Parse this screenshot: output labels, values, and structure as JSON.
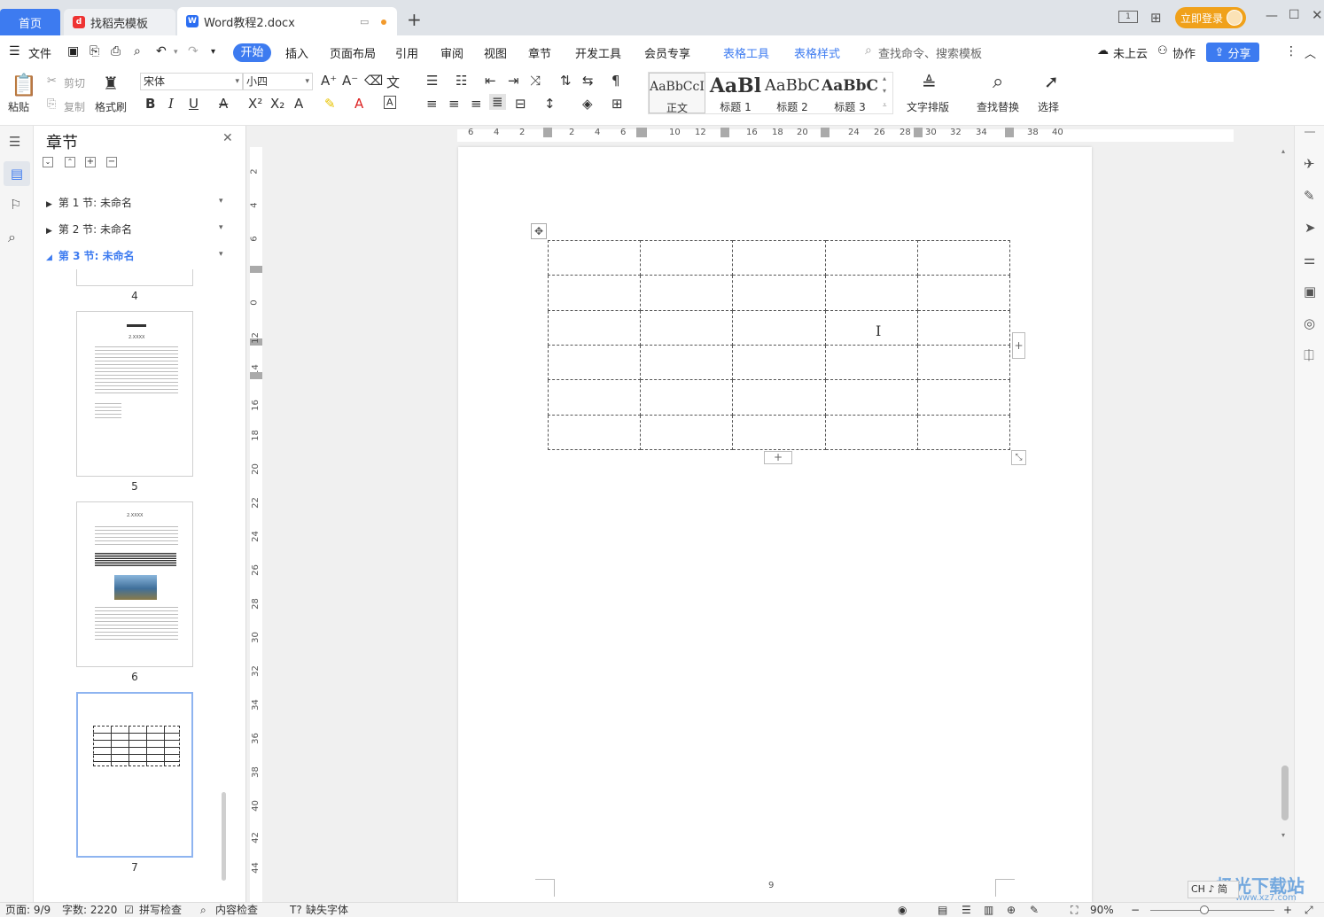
{
  "tabs": {
    "home": "首页",
    "daoke": "找稻壳模板",
    "doc": "Word教程2.docx",
    "login": "立即登录"
  },
  "menu": {
    "file": "文件",
    "items": [
      "开始",
      "插入",
      "页面布局",
      "引用",
      "审阅",
      "视图",
      "章节",
      "开发工具",
      "会员专享"
    ],
    "table_tools": "表格工具",
    "table_style": "表格样式",
    "search": "查找命令、搜索模板",
    "cloud": "未上云",
    "collab": "协作",
    "share": "分享"
  },
  "toolbar": {
    "paste": "粘贴",
    "cut": "剪切",
    "copy": "复制",
    "format_painter": "格式刷",
    "font": "宋体",
    "size": "小四",
    "styles": [
      {
        "preview": "AaBbCcI",
        "name": "正文"
      },
      {
        "preview": "AaBl",
        "name": "标题 1"
      },
      {
        "preview": "AaBbC",
        "name": "标题 2"
      },
      {
        "preview": "AaBbC",
        "name": "标题 3"
      }
    ],
    "text_layout": "文字排版",
    "find_replace": "查找替换",
    "select": "选择"
  },
  "panel": {
    "title": "章节",
    "sections": [
      "第 1 节: 未命名",
      "第 2 节: 未命名",
      "第 3 节: 未命名"
    ],
    "thumb_text": "2.XXXX",
    "pages": [
      "4",
      "5",
      "6",
      "7"
    ]
  },
  "ruler": {
    "h": [
      "6",
      "4",
      "2",
      "2",
      "4",
      "6",
      "10",
      "12",
      "16",
      "18",
      "20",
      "24",
      "26",
      "28",
      "30",
      "32",
      "34",
      "38",
      "40"
    ],
    "v": [
      "2",
      "4",
      "6",
      "0",
      "12",
      "14",
      "16",
      "18",
      "20",
      "22",
      "24",
      "26",
      "28",
      "30",
      "32",
      "34",
      "36",
      "38",
      "40",
      "42",
      "44"
    ]
  },
  "page": {
    "number": "9"
  },
  "status": {
    "page": "页面: 9/9",
    "words": "字数: 2220",
    "spell": "拼写检查",
    "content": "内容检查",
    "missing_font": "缺失字体",
    "zoom": "90%",
    "ime": "CH ♪ 简"
  },
  "watermark": {
    "text": "极光下载站",
    "url": "www.xz7.com"
  }
}
